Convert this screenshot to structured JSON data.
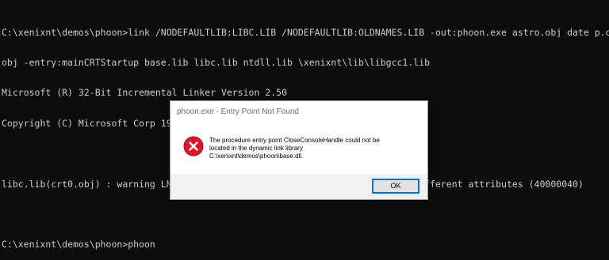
{
  "console": {
    "lines": [
      "C:\\xenixnt\\demos\\phoon>link /NODEFAULTLIB:LIBC.LIB /NODEFAULTLIB:OLDNAMES.LIB -out:phoon.exe astro.obj date_p.obj phoon.",
      "obj -entry:mainCRTStartup base.lib libc.lib ntdll.lib \\xenixnt\\lib\\libgcc1.lib",
      "Microsoft (R) 32-Bit Incremental Linker Version 2.50",
      "Copyright (C) Microsoft Corp 1992-94. All rights reserved.",
      "",
      "libc.lib(crt0.obj) : warning LNK4078: multiple \".data\" sections found with different attributes (40000040)",
      "",
      "C:\\xenixnt\\demos\\phoon>phoon"
    ]
  },
  "dialog": {
    "title": "phoon.exe - Entry Point Not Found",
    "icon": "error-icon",
    "message_lines": [
      "The procedure entry point CloseConsoleHandle could not be",
      "located in the dynamic link library",
      "C:\\xenixnt\\demos\\phoon\\base.dll."
    ],
    "ok_label": "OK"
  },
  "colors": {
    "console_background": "#0c0c0c",
    "console_text": "#cccccc",
    "error_red": "#e81123",
    "button_focus": "#0078d7"
  }
}
